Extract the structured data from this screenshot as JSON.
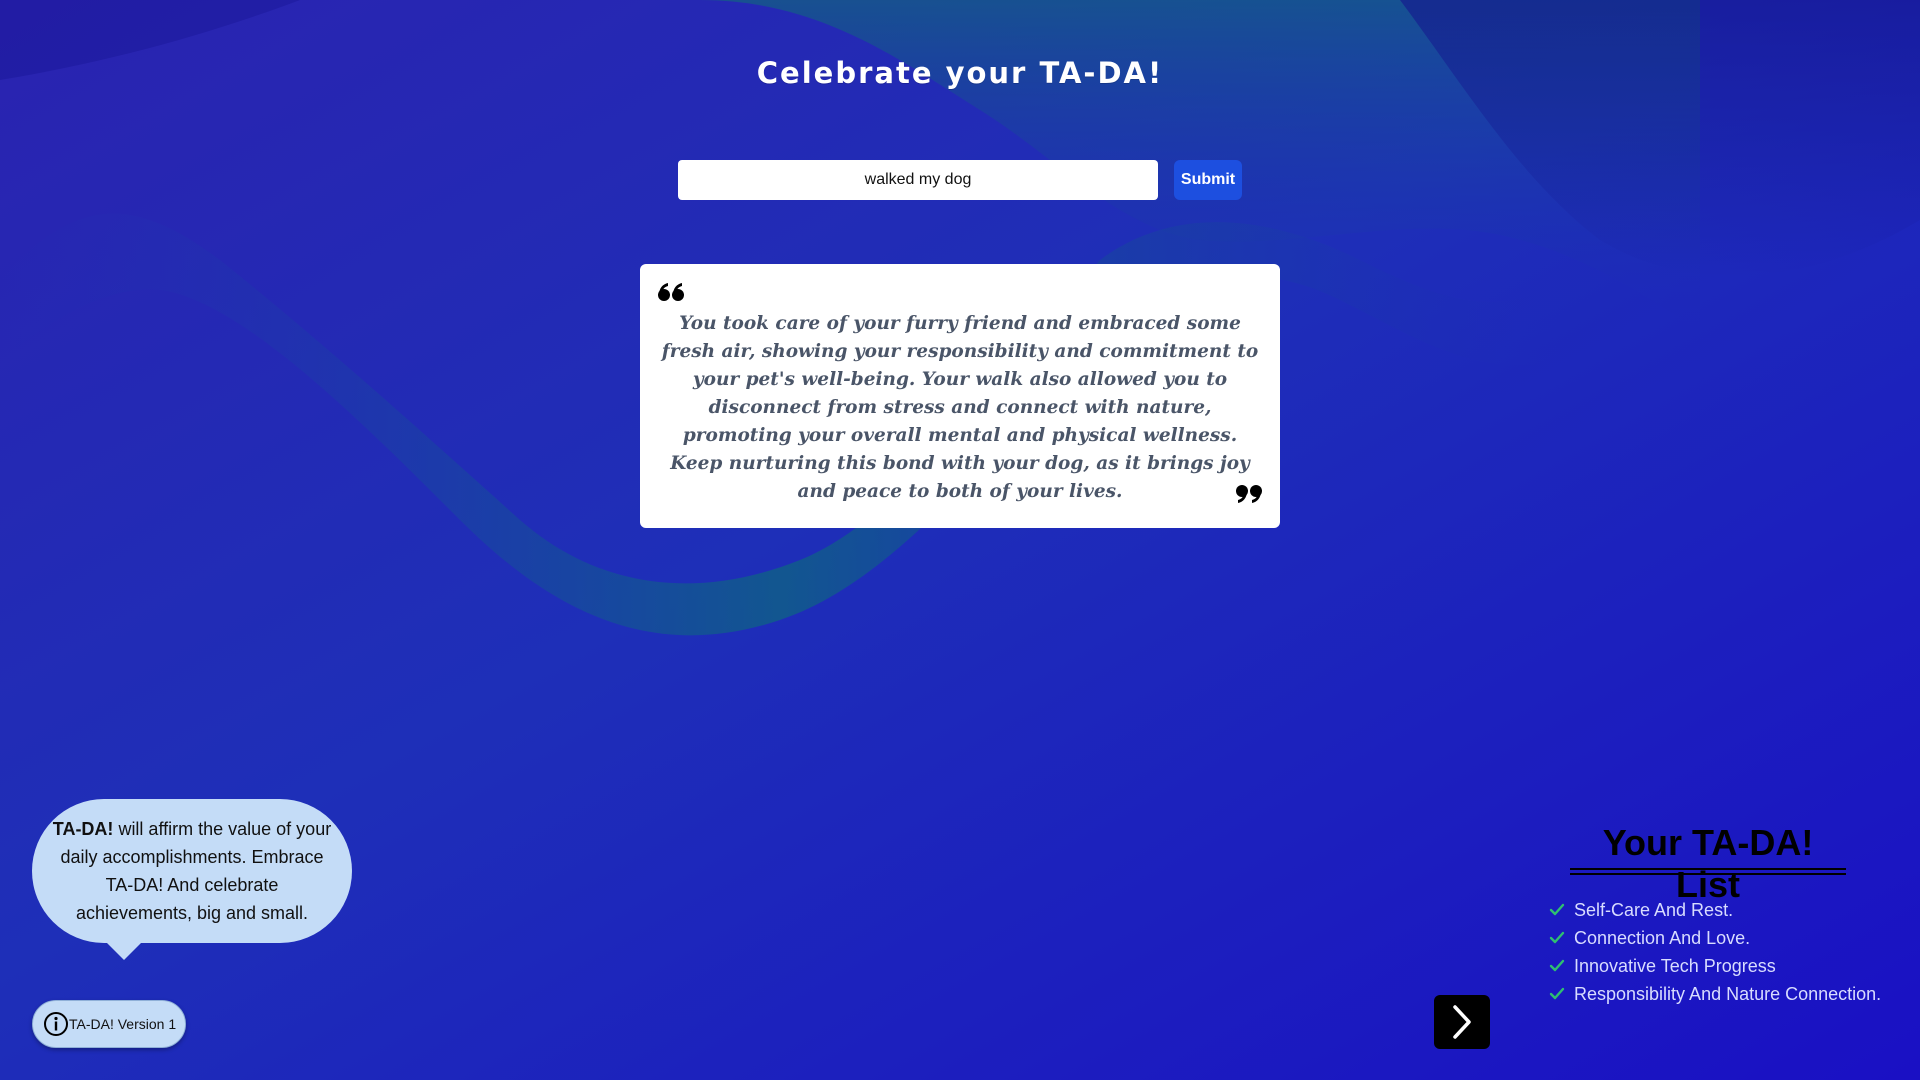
{
  "app": {
    "title": "Celebrate your TA-DA!"
  },
  "search": {
    "value": "walked my dog",
    "submit_label": "Submit"
  },
  "quote": {
    "open_icon": "quote-open-icon",
    "close_icon": "quote-close-icon",
    "text": "You took care of your furry friend and embraced some fresh air, showing your responsibility and commitment to your pet's well-being. Your walk also allowed you to disconnect from stress and connect with nature, promoting your overall mental and physical wellness. Keep nurturing this bond with your dog, as it brings joy and peace to both of your lives."
  },
  "bubble": {
    "brand": "TA-DA!",
    "text": " will affirm the value of your daily accomplishments. Embrace TA-DA! And celebrate achievements, big and small."
  },
  "version": {
    "icon": "info-icon",
    "label": "TA-DA! Version 1"
  },
  "navigation": {
    "next_icon": "chevron-right-icon"
  },
  "ta_list": {
    "title": "Your TA-DA! List",
    "item_icon": "check-icon",
    "items": [
      "Self-Care And Rest.",
      "Connection And Love.",
      "Innovative Tech Progress",
      "Responsibility And Nature Connection."
    ]
  },
  "colors": {
    "background": "#1a17b8",
    "wave_teal": "#0f6a7a",
    "submit_button": "#1d4fe0",
    "bubble": "#c4dcf7",
    "check": "#2fbf71",
    "list_text": "#d8dcff"
  }
}
